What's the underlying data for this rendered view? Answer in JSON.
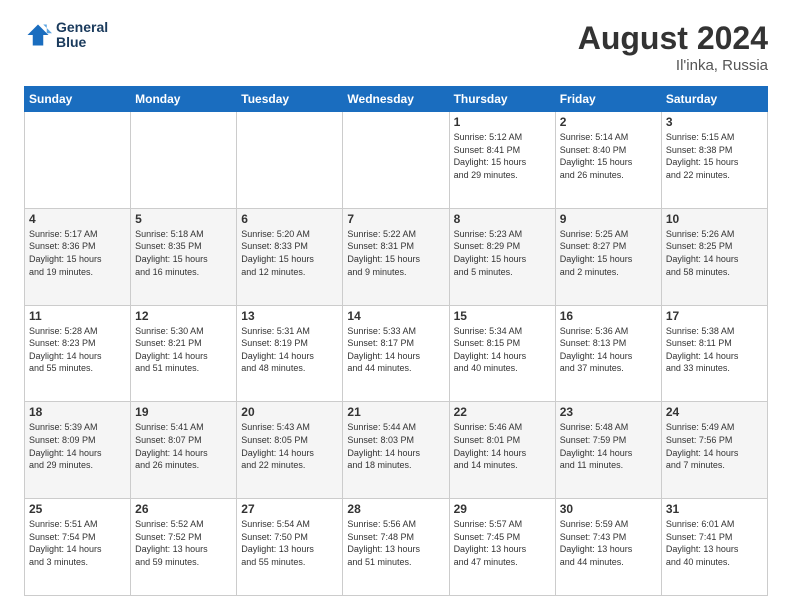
{
  "header": {
    "logo_line1": "General",
    "logo_line2": "Blue",
    "title": "August 2024",
    "subtitle": "Il'inka, Russia"
  },
  "days_of_week": [
    "Sunday",
    "Monday",
    "Tuesday",
    "Wednesday",
    "Thursday",
    "Friday",
    "Saturday"
  ],
  "weeks": [
    [
      {
        "day": "",
        "info": ""
      },
      {
        "day": "",
        "info": ""
      },
      {
        "day": "",
        "info": ""
      },
      {
        "day": "",
        "info": ""
      },
      {
        "day": "1",
        "info": "Sunrise: 5:12 AM\nSunset: 8:41 PM\nDaylight: 15 hours\nand 29 minutes."
      },
      {
        "day": "2",
        "info": "Sunrise: 5:14 AM\nSunset: 8:40 PM\nDaylight: 15 hours\nand 26 minutes."
      },
      {
        "day": "3",
        "info": "Sunrise: 5:15 AM\nSunset: 8:38 PM\nDaylight: 15 hours\nand 22 minutes."
      }
    ],
    [
      {
        "day": "4",
        "info": "Sunrise: 5:17 AM\nSunset: 8:36 PM\nDaylight: 15 hours\nand 19 minutes."
      },
      {
        "day": "5",
        "info": "Sunrise: 5:18 AM\nSunset: 8:35 PM\nDaylight: 15 hours\nand 16 minutes."
      },
      {
        "day": "6",
        "info": "Sunrise: 5:20 AM\nSunset: 8:33 PM\nDaylight: 15 hours\nand 12 minutes."
      },
      {
        "day": "7",
        "info": "Sunrise: 5:22 AM\nSunset: 8:31 PM\nDaylight: 15 hours\nand 9 minutes."
      },
      {
        "day": "8",
        "info": "Sunrise: 5:23 AM\nSunset: 8:29 PM\nDaylight: 15 hours\nand 5 minutes."
      },
      {
        "day": "9",
        "info": "Sunrise: 5:25 AM\nSunset: 8:27 PM\nDaylight: 15 hours\nand 2 minutes."
      },
      {
        "day": "10",
        "info": "Sunrise: 5:26 AM\nSunset: 8:25 PM\nDaylight: 14 hours\nand 58 minutes."
      }
    ],
    [
      {
        "day": "11",
        "info": "Sunrise: 5:28 AM\nSunset: 8:23 PM\nDaylight: 14 hours\nand 55 minutes."
      },
      {
        "day": "12",
        "info": "Sunrise: 5:30 AM\nSunset: 8:21 PM\nDaylight: 14 hours\nand 51 minutes."
      },
      {
        "day": "13",
        "info": "Sunrise: 5:31 AM\nSunset: 8:19 PM\nDaylight: 14 hours\nand 48 minutes."
      },
      {
        "day": "14",
        "info": "Sunrise: 5:33 AM\nSunset: 8:17 PM\nDaylight: 14 hours\nand 44 minutes."
      },
      {
        "day": "15",
        "info": "Sunrise: 5:34 AM\nSunset: 8:15 PM\nDaylight: 14 hours\nand 40 minutes."
      },
      {
        "day": "16",
        "info": "Sunrise: 5:36 AM\nSunset: 8:13 PM\nDaylight: 14 hours\nand 37 minutes."
      },
      {
        "day": "17",
        "info": "Sunrise: 5:38 AM\nSunset: 8:11 PM\nDaylight: 14 hours\nand 33 minutes."
      }
    ],
    [
      {
        "day": "18",
        "info": "Sunrise: 5:39 AM\nSunset: 8:09 PM\nDaylight: 14 hours\nand 29 minutes."
      },
      {
        "day": "19",
        "info": "Sunrise: 5:41 AM\nSunset: 8:07 PM\nDaylight: 14 hours\nand 26 minutes."
      },
      {
        "day": "20",
        "info": "Sunrise: 5:43 AM\nSunset: 8:05 PM\nDaylight: 14 hours\nand 22 minutes."
      },
      {
        "day": "21",
        "info": "Sunrise: 5:44 AM\nSunset: 8:03 PM\nDaylight: 14 hours\nand 18 minutes."
      },
      {
        "day": "22",
        "info": "Sunrise: 5:46 AM\nSunset: 8:01 PM\nDaylight: 14 hours\nand 14 minutes."
      },
      {
        "day": "23",
        "info": "Sunrise: 5:48 AM\nSunset: 7:59 PM\nDaylight: 14 hours\nand 11 minutes."
      },
      {
        "day": "24",
        "info": "Sunrise: 5:49 AM\nSunset: 7:56 PM\nDaylight: 14 hours\nand 7 minutes."
      }
    ],
    [
      {
        "day": "25",
        "info": "Sunrise: 5:51 AM\nSunset: 7:54 PM\nDaylight: 14 hours\nand 3 minutes."
      },
      {
        "day": "26",
        "info": "Sunrise: 5:52 AM\nSunset: 7:52 PM\nDaylight: 13 hours\nand 59 minutes."
      },
      {
        "day": "27",
        "info": "Sunrise: 5:54 AM\nSunset: 7:50 PM\nDaylight: 13 hours\nand 55 minutes."
      },
      {
        "day": "28",
        "info": "Sunrise: 5:56 AM\nSunset: 7:48 PM\nDaylight: 13 hours\nand 51 minutes."
      },
      {
        "day": "29",
        "info": "Sunrise: 5:57 AM\nSunset: 7:45 PM\nDaylight: 13 hours\nand 47 minutes."
      },
      {
        "day": "30",
        "info": "Sunrise: 5:59 AM\nSunset: 7:43 PM\nDaylight: 13 hours\nand 44 minutes."
      },
      {
        "day": "31",
        "info": "Sunrise: 6:01 AM\nSunset: 7:41 PM\nDaylight: 13 hours\nand 40 minutes."
      }
    ]
  ]
}
